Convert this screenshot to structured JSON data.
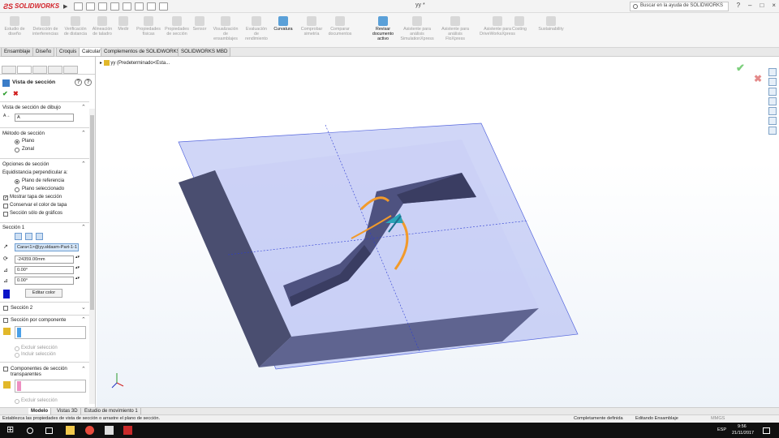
{
  "app": {
    "brand": "SOLIDWORKS",
    "document_title": "yy *",
    "search_placeholder": "Buscar en la ayuda de SOLIDWORKS"
  },
  "commands": [
    {
      "label": "Estudio de diseño",
      "active": false
    },
    {
      "label": "Detección de interferencias",
      "active": false
    },
    {
      "label": "Verificación de distancia",
      "active": false
    },
    {
      "label": "Alineación de taladro",
      "active": false
    },
    {
      "label": "Medir",
      "active": false
    },
    {
      "label": "Propiedades físicas",
      "active": false
    },
    {
      "label": "Propiedades de sección",
      "active": false
    },
    {
      "label": "Sensor",
      "active": false
    },
    {
      "label": "Visualización de ensamblajes",
      "active": false
    },
    {
      "label": "Evaluación de rendimiento",
      "active": false
    },
    {
      "label": "Curvatura",
      "active": true
    },
    {
      "label": "Comprobar simetría",
      "active": false
    },
    {
      "label": "Comparar documentos",
      "active": false
    },
    {
      "label": "Revisar documento activo",
      "active": true
    },
    {
      "label": "Asistente para análisis SimulationXpress",
      "active": false
    },
    {
      "label": "Asistente para análisis FloXpress",
      "active": false
    },
    {
      "label": "Asistente para DriveWorksXpress",
      "active": false
    },
    {
      "label": "Costing",
      "active": false
    },
    {
      "label": "Sustainability",
      "active": false
    }
  ],
  "tabs": [
    "Ensamblaje",
    "Diseño",
    "Croquis",
    "Calcular",
    "Complementos de SOLIDWORKS",
    "SOLIDWORKS MBD"
  ],
  "selected_tab": "Calcular",
  "property_manager": {
    "title": "Vista de sección",
    "section_view_label": "Vista de sección de dibujo",
    "section_view_value": "A",
    "method_header": "Método de sección",
    "method_options": [
      "Plano",
      "Zonal"
    ],
    "method_selected": "Plano",
    "options_header": "Opciones de sección",
    "equidistance_label": "Equidistancia perpendicular a:",
    "equidistance_options": [
      "Plano de referencia",
      "Plano seleccionado"
    ],
    "equidistance_selected": "Plano de referencia",
    "checkbox_show_cap": "Mostrar tapa de sección",
    "checkbox_keep_color": "Conservar el color de tapa",
    "checkbox_graphics_only": "Sección sólo de gráficos",
    "section1_header": "Sección 1",
    "section1_reference": "Cara<1>@yy.sldasm-Part-1-1",
    "section1_offset": "-24359.00mm",
    "section1_angle_x": "0.00°",
    "section1_angle_y": "0.00°",
    "section1_color": "#0a14c8",
    "edit_color_button": "Editar color",
    "section2_header": "Sección 2",
    "by_component_header": "Sección por componente",
    "exclude_selection": "Excluir selección",
    "include_selection": "Incluir selección",
    "transparent_header": "Componentes de sección transparentes",
    "transparent_exclude": "Excluir selección"
  },
  "feature_tree": {
    "root": "yy (Predeterminado<Esta..."
  },
  "bottom_tabs": [
    "Modelo",
    "Vistas 3D",
    "Estudio de movimiento 1"
  ],
  "status": {
    "message": "Establezca las propiedades de vista de sección o arrastre el plano de sección.",
    "state": "Completamente definida",
    "mode": "Editando Ensamblaje",
    "units": "MMGS"
  },
  "taskbar": {
    "language": "ESP",
    "time": "9:56",
    "date": "21/11/2017"
  }
}
